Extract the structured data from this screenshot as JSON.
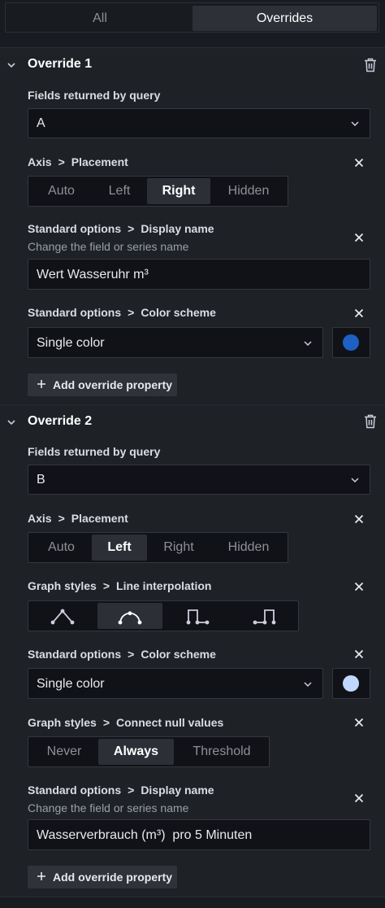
{
  "tabs": {
    "all": "All",
    "overrides": "Overrides"
  },
  "colors": {
    "blue": "#1f60c4",
    "light_blue": "#c0d8ff",
    "background": "#181b1f"
  },
  "override1": {
    "title": "Override 1",
    "matcher_label": "Fields returned by query",
    "matcher_value": "A",
    "axis": {
      "category": "Axis",
      "name": "Placement",
      "options": [
        "Auto",
        "Left",
        "Right",
        "Hidden"
      ],
      "selected": "Right"
    },
    "display_name": {
      "category": "Standard options",
      "name": "Display name",
      "description": "Change the field or series name",
      "value": "Wert Wasseruhr m³"
    },
    "color": {
      "category": "Standard options",
      "name": "Color scheme",
      "value": "Single color"
    },
    "add_label": "Add override property"
  },
  "override2": {
    "title": "Override 2",
    "matcher_label": "Fields returned by query",
    "matcher_value": "B",
    "axis": {
      "category": "Axis",
      "name": "Placement",
      "options": [
        "Auto",
        "Left",
        "Right",
        "Hidden"
      ],
      "selected": "Left"
    },
    "interpolation": {
      "category": "Graph styles",
      "name": "Line interpolation",
      "options": [
        "linear-icon",
        "smooth-icon",
        "step-after-icon",
        "step-before-icon"
      ],
      "selected": "smooth-icon"
    },
    "color": {
      "category": "Standard options",
      "name": "Color scheme",
      "value": "Single color"
    },
    "connect_null": {
      "category": "Graph styles",
      "name": "Connect null values",
      "options": [
        "Never",
        "Always",
        "Threshold"
      ],
      "selected": "Always"
    },
    "display_name": {
      "category": "Standard options",
      "name": "Display name",
      "description": "Change the field or series name",
      "value": "Wasserverbrauch (m³)  pro 5 Minuten"
    },
    "add_label": "Add override property"
  }
}
